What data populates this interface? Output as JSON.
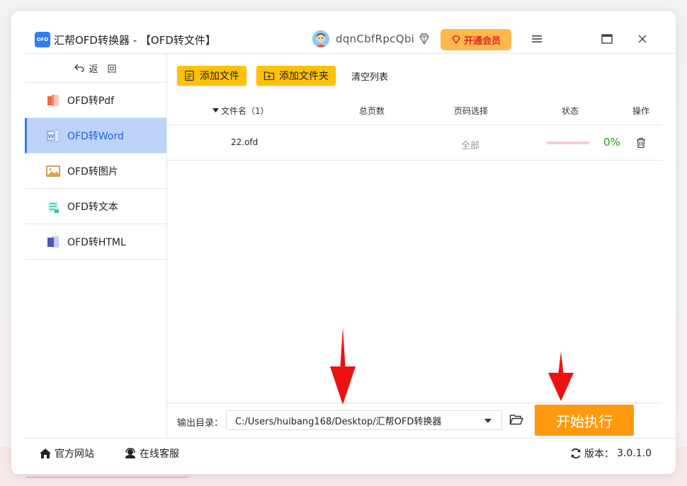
{
  "app": {
    "logo_text": "OFD",
    "title": "汇帮OFD转换器 - 【OFD转文件】",
    "username": "dqnCbfRpcQbi",
    "vip_label": "开通会员"
  },
  "sidebar": {
    "back_label": "返　回",
    "items": [
      {
        "label": "OFD转Pdf",
        "icon": "pdf-icon",
        "active": false
      },
      {
        "label": "OFD转Word",
        "icon": "word-icon",
        "active": true
      },
      {
        "label": "OFD转图片",
        "icon": "image-icon",
        "active": false
      },
      {
        "label": "OFD转文本",
        "icon": "text-icon",
        "active": false
      },
      {
        "label": "OFD转HTML",
        "icon": "html-icon",
        "active": false
      }
    ]
  },
  "toolbar": {
    "add_file_label": "添加文件",
    "add_folder_label": "添加文件夹",
    "clear_label": "清空列表"
  },
  "table": {
    "headers": {
      "filename": "文件名（1）",
      "pages": "总页数",
      "page_select": "页码选择",
      "status": "状态",
      "action": "操作"
    },
    "rows": [
      {
        "filename": "22.ofd",
        "pages": "",
        "page_select": "全部",
        "progress_percent": 0,
        "status_text": "0%"
      }
    ]
  },
  "output": {
    "label": "输出目录：",
    "path": "C:/Users/huibang168/Desktop/汇帮OFD转换器",
    "start_label": "开始执行"
  },
  "footer": {
    "website_label": "官方网站",
    "support_label": "在线客服",
    "version_label": "版本：",
    "version_value": "3.0.1.0"
  },
  "colors": {
    "accent_blue": "#3a7fe3",
    "toolbar_yellow": "#ffc107",
    "start_orange": "#ff9a10",
    "vip_orange": "#ffb84a",
    "progress_green": "#1aa51a",
    "annotation_red": "#ee1111"
  }
}
